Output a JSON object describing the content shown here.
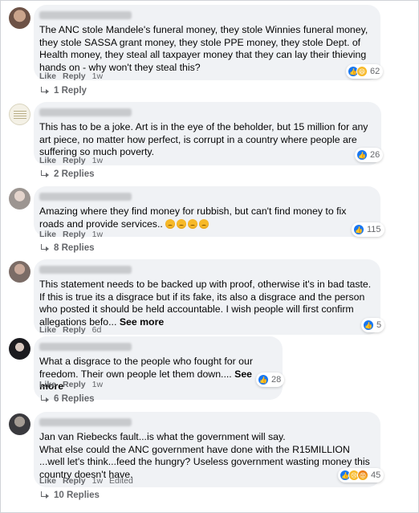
{
  "actions": {
    "like": "Like",
    "reply": "Reply",
    "edited": "Edited"
  },
  "comments": [
    {
      "text": "The ANC stole Mandele's funeral money, they stole Winnies funeral money, they stole SASSA grant money, they stole PPE money, they stole Dept. of Health money, they steal all taxpayer money that they can lay their thieving hands on - why won't they steal this?",
      "time": "1w",
      "reaction_icons": [
        "like-icon",
        "haha-icon"
      ],
      "reaction_count": "62",
      "replies": "1 Reply"
    },
    {
      "text": "This has to be a joke. Art is in the eye of the beholder, but 15 million for any art piece, no matter how perfect, is corrupt in a country where people are suffering so much poverty.",
      "time": "1w",
      "reaction_icons": [
        "like-icon"
      ],
      "reaction_count": "26",
      "replies": "2 Replies"
    },
    {
      "text": "Amazing where they find money for rubbish, but can't find money to fix roads and provide services..",
      "emojis": [
        "angry-face-emoji",
        "angry-face-emoji",
        "angry-face-emoji",
        "angry-face-emoji"
      ],
      "time": "1w",
      "reaction_icons": [
        "like-icon"
      ],
      "reaction_count": "115",
      "replies": "8 Replies"
    },
    {
      "text": "This statement needs to be backed up with proof, otherwise it's in bad taste. If this is true its a disgrace but if its fake, its also a disgrace and the person who posted it should be held accountable. I wish people will first confirm allegations befo...",
      "see_more": "See more",
      "time": "6d",
      "reaction_icons": [
        "like-icon"
      ],
      "reaction_count": "5"
    },
    {
      "text": "What a disgrace to the people who fought for our freedom. Their own people let them down....",
      "see_more": "See more",
      "time": "1w",
      "reaction_icons": [
        "like-icon"
      ],
      "reaction_count": "28",
      "replies": "6 Replies"
    },
    {
      "text_lines": [
        "Jan van Riebecks fault...is what the government will say.",
        "What else could the ANC government have done with the R15MILLION ...well let's think...feed the hungry? Useless government wasting money this country doesn't have."
      ],
      "time": "1w",
      "edited": true,
      "reaction_icons": [
        "like-icon",
        "sad-icon",
        "angry-icon"
      ],
      "reaction_count": "45",
      "replies": "10 Replies"
    }
  ]
}
